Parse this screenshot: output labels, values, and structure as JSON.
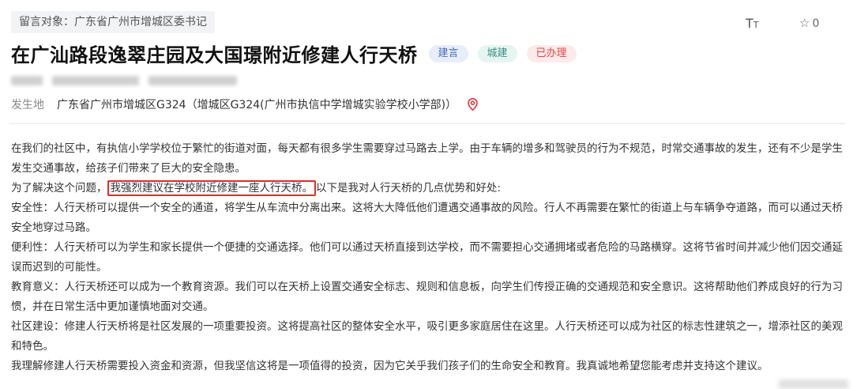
{
  "header": {
    "recipient": "留言对象：广东省广州市增城区委书记",
    "font_size_icon_big": "T",
    "font_size_icon_small": "T",
    "favorite_count": "0"
  },
  "title": {
    "text": "在广汕路段逸翠庄园及大国璟附近修建人行天桥",
    "tags": [
      {
        "label": "建言"
      },
      {
        "label": "城建"
      },
      {
        "label": "已办理"
      }
    ]
  },
  "location": {
    "label": "发生地",
    "value": "广东省广州市增城区G324（增城区G324(广州市执信中学增城实验学校小学部)）"
  },
  "content": {
    "p1": "在我们的社区中，有执信小学学校位于繁忙的街道对面，每天都有很多学生需要穿过马路去上学。由于车辆的增多和驾驶员的行为不规范，时常交通事故的发生，还有不少是学生发生交通事故，给孩子们带来了巨大的安全隐患。",
    "p2_prefix": "为了解决这个问题，",
    "p2_highlight": "我强烈建议在学校附近修建一座人行天桥。",
    "p2_suffix": "以下是我对人行天桥的几点优势和好处:",
    "p3": "安全性：人行天桥可以提供一个安全的通道，将学生从车流中分离出来。这将大大降低他们遭遇交通事故的风险。行人不再需要在繁忙的街道上与车辆争夺道路，而可以通过天桥安全地穿过马路。",
    "p4": "便利性：人行天桥可以为学生和家长提供一个便捷的交通选择。他们可以通过天桥直接到达学校，而不需要担心交通拥堵或者危险的马路横穿。这将节省时间并减少他们因交通延误而迟到的可能性。",
    "p5": "教育意义：人行天桥还可以成为一个教育资源。我们可以在天桥上设置交通安全标志、规则和信息板，向学生们传授正确的交通规范和安全意识。这将帮助他们养成良好的行为习惯，并在日常生活中更加谨慎地面对交通。",
    "p6": "社区建设：修建人行天桥将是社区发展的一项重要投资。这将提高社区的整体安全水平，吸引更多家庭居住在这里。人行天桥还可以成为社区的标志性建筑之一，增添社区的美观和特色。",
    "p7": "我理解修建人行天桥需要投入资金和资源，但我坚信这将是一项值得的投资，因为它关乎我们孩子们的生命安全和教育。我真诚地希望您能考虑并支持这个建议。"
  },
  "colors": {
    "highlight_border": "#e12b2b",
    "pin": "#e0363e",
    "tag_suggest_text": "#4a6fb5",
    "tag_category_text": "#3a8f7e",
    "tag_status_text": "#e04848"
  },
  "icons": {
    "font_size": "font-size-icon",
    "favorite": "star-icon",
    "location": "location-pin-icon"
  }
}
